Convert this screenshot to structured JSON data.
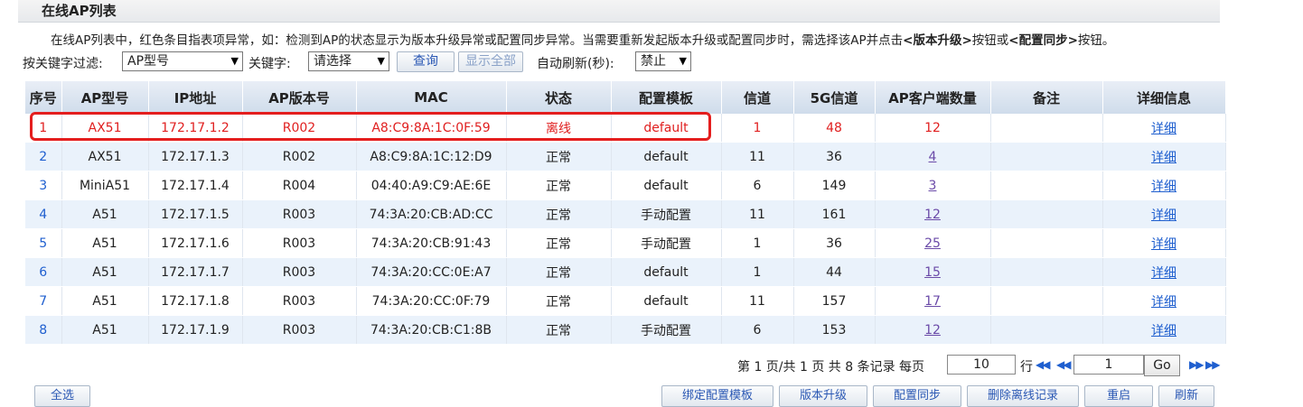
{
  "section_title": "在线AP列表",
  "description": {
    "text": "在线AP列表中，红色条目指表项异常，如：检测到AP的状态显示为版本升级异常或配置同步异常。当需要重新发起版本升级或配置同步时，需选择该AP并点击",
    "upgrade_label": "<版本升级>",
    "mid": "按钮或",
    "sync_label": "<配置同步>",
    "tail": "按钮。"
  },
  "filter": {
    "filter_label": "按关键字过滤:",
    "field_value": "AP型号",
    "keyword_label": "关键字:",
    "keyword_value": "请选择",
    "query_button": "查询",
    "show_all_button": "显示全部",
    "auto_refresh_label": "自动刷新(秒):",
    "auto_refresh_value": "禁止"
  },
  "table": {
    "headers": [
      "序号",
      "AP型号",
      "IP地址",
      "AP版本号",
      "MAC",
      "状态",
      "配置模板",
      "信道",
      "5G信道",
      "AP客户端数量",
      "备注",
      "详细信息"
    ],
    "rows": [
      {
        "idx": "1",
        "model": "AX51",
        "ip": "172.17.1.2",
        "ver": "R002",
        "mac": "A8:C9:8A:1C:0F:59",
        "status": "离线",
        "tpl": "default",
        "ch": "1",
        "ch5g": "48",
        "clients": "12",
        "note": "",
        "detail": "详细"
      },
      {
        "idx": "2",
        "model": "AX51",
        "ip": "172.17.1.3",
        "ver": "R002",
        "mac": "A8:C9:8A:1C:12:D9",
        "status": "正常",
        "tpl": "default",
        "ch": "11",
        "ch5g": "36",
        "clients": "4",
        "note": "",
        "detail": "详细"
      },
      {
        "idx": "3",
        "model": "MiniA51",
        "ip": "172.17.1.4",
        "ver": "R004",
        "mac": "04:40:A9:C9:AE:6E",
        "status": "正常",
        "tpl": "default",
        "ch": "6",
        "ch5g": "149",
        "clients": "3",
        "note": "",
        "detail": "详细"
      },
      {
        "idx": "4",
        "model": "A51",
        "ip": "172.17.1.5",
        "ver": "R003",
        "mac": "74:3A:20:CB:AD:CC",
        "status": "正常",
        "tpl": "手动配置",
        "ch": "11",
        "ch5g": "161",
        "clients": "12",
        "note": "",
        "detail": "详细"
      },
      {
        "idx": "5",
        "model": "A51",
        "ip": "172.17.1.6",
        "ver": "R003",
        "mac": "74:3A:20:CB:91:43",
        "status": "正常",
        "tpl": "手动配置",
        "ch": "1",
        "ch5g": "36",
        "clients": "25",
        "note": "",
        "detail": "详细"
      },
      {
        "idx": "6",
        "model": "A51",
        "ip": "172.17.1.7",
        "ver": "R003",
        "mac": "74:3A:20:CC:0E:A7",
        "status": "正常",
        "tpl": "default",
        "ch": "1",
        "ch5g": "44",
        "clients": "15",
        "note": "",
        "detail": "详细"
      },
      {
        "idx": "7",
        "model": "A51",
        "ip": "172.17.1.8",
        "ver": "R003",
        "mac": "74:3A:20:CC:0F:79",
        "status": "正常",
        "tpl": "default",
        "ch": "11",
        "ch5g": "157",
        "clients": "17",
        "note": "",
        "detail": "详细"
      },
      {
        "idx": "8",
        "model": "A51",
        "ip": "172.17.1.9",
        "ver": "R003",
        "mac": "74:3A:20:CB:C1:8B",
        "status": "正常",
        "tpl": "手动配置",
        "ch": "6",
        "ch5g": "153",
        "clients": "12",
        "note": "",
        "detail": "详细"
      }
    ]
  },
  "pager": {
    "summary": "第 1 页/共 1 页 共 8 条记录 每页",
    "per_page": "10",
    "row_label": "行",
    "page_input": "1",
    "go_button": "Go"
  },
  "bottom_buttons": {
    "select_all": "全选",
    "bind_template": "绑定配置模板",
    "upgrade": "版本升级",
    "sync": "配置同步",
    "delete_offline": "删除离线记录",
    "reboot": "重启",
    "refresh": "刷新"
  },
  "colors": {
    "alert_text": "#e02020",
    "highlight_border": "#e41e1e",
    "link": "#1f5fcf",
    "header_bg": "#cfdceb",
    "even_row": "#eaf2fb"
  }
}
